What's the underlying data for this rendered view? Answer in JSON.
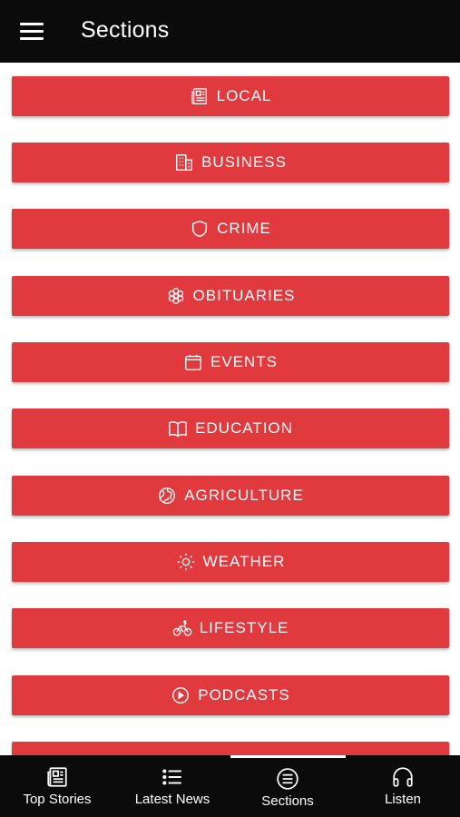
{
  "header": {
    "title": "Sections"
  },
  "sections": [
    {
      "label": "LOCAL",
      "icon": "newspaper-icon"
    },
    {
      "label": "BUSINESS",
      "icon": "building-icon"
    },
    {
      "label": "CRIME",
      "icon": "shield-icon"
    },
    {
      "label": "OBITUARIES",
      "icon": "flower-icon"
    },
    {
      "label": "EVENTS",
      "icon": "calendar-icon"
    },
    {
      "label": "EDUCATION",
      "icon": "book-icon"
    },
    {
      "label": "AGRICULTURE",
      "icon": "globe-icon"
    },
    {
      "label": "WEATHER",
      "icon": "sun-icon"
    },
    {
      "label": "LIFESTYLE",
      "icon": "bicycle-icon"
    },
    {
      "label": "PODCASTS",
      "icon": "play-circle-icon"
    }
  ],
  "bottom_nav": {
    "items": [
      {
        "label": "Top Stories",
        "icon": "newspaper-icon"
      },
      {
        "label": "Latest News",
        "icon": "list-icon"
      },
      {
        "label": "Sections",
        "icon": "sections-icon"
      },
      {
        "label": "Listen",
        "icon": "headphones-icon"
      }
    ],
    "active_index": 2
  },
  "colors": {
    "header_bg": "#0b0b0b",
    "section_button_bg": "#e0393e",
    "text": "#ffffff"
  }
}
